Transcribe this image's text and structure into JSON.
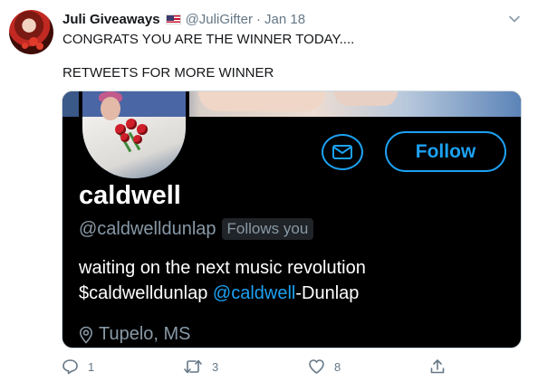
{
  "tweet": {
    "display_name": "Juli Giveaways",
    "handle": "@JuliGifter",
    "separator": "·",
    "date": "Jan 18",
    "text_line1": "CONGRATS YOU ARE THE WINNER TODAY....",
    "text_line2": "RETWEETS FOR MORE WINNER"
  },
  "embedded_profile": {
    "name": "caldwell",
    "handle": "@caldwelldunlap",
    "follows_you": "Follows you",
    "follow_button": "Follow",
    "bio_line1": "waiting on the next music revolution",
    "bio_line2_prefix": "$caldwelldunlap ",
    "bio_line2_mention": "@caldwell",
    "bio_line2_suffix": "-Dunlap",
    "location": "Tupelo, MS"
  },
  "actions": {
    "reply_count": "1",
    "retweet_count": "3",
    "like_count": "8"
  },
  "colors": {
    "accent": "#1da1f2",
    "muted": "#657786"
  }
}
